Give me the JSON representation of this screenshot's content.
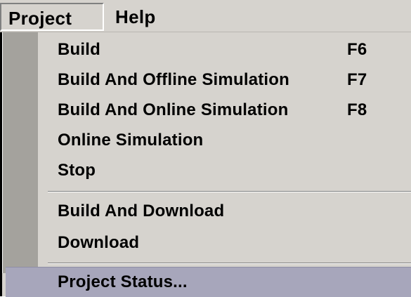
{
  "menubar": {
    "items": [
      {
        "label": "Project"
      },
      {
        "label": "Help"
      }
    ]
  },
  "menu": {
    "items": [
      {
        "label": "Build",
        "shortcut": "F6"
      },
      {
        "label": "Build And Offline Simulation",
        "shortcut": "F7"
      },
      {
        "label": "Build And Online Simulation",
        "shortcut": "F8"
      },
      {
        "label": "Online Simulation",
        "shortcut": ""
      },
      {
        "label": "Stop",
        "shortcut": ""
      },
      {
        "label": "Build And Download",
        "shortcut": ""
      },
      {
        "label": "Download",
        "shortcut": ""
      },
      {
        "label": "Project Status...",
        "shortcut": "",
        "highlighted": true
      }
    ]
  },
  "colors": {
    "menu_background": "#d6d3ce",
    "gutter": "#a4a29d",
    "highlight": "#a7a6bb"
  }
}
